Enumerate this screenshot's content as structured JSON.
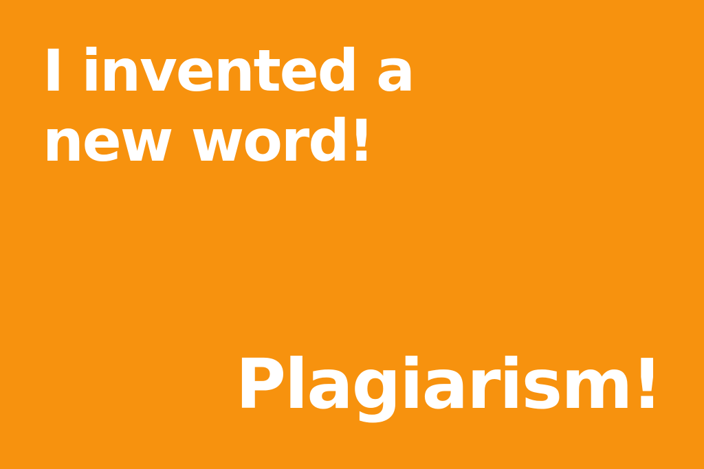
{
  "joke": {
    "setup_lines": [
      "I invented a",
      "new word!"
    ],
    "punchline": "Plagiarism!"
  },
  "colors": {
    "background": "#F7920E",
    "text": "#FFFFFF"
  }
}
